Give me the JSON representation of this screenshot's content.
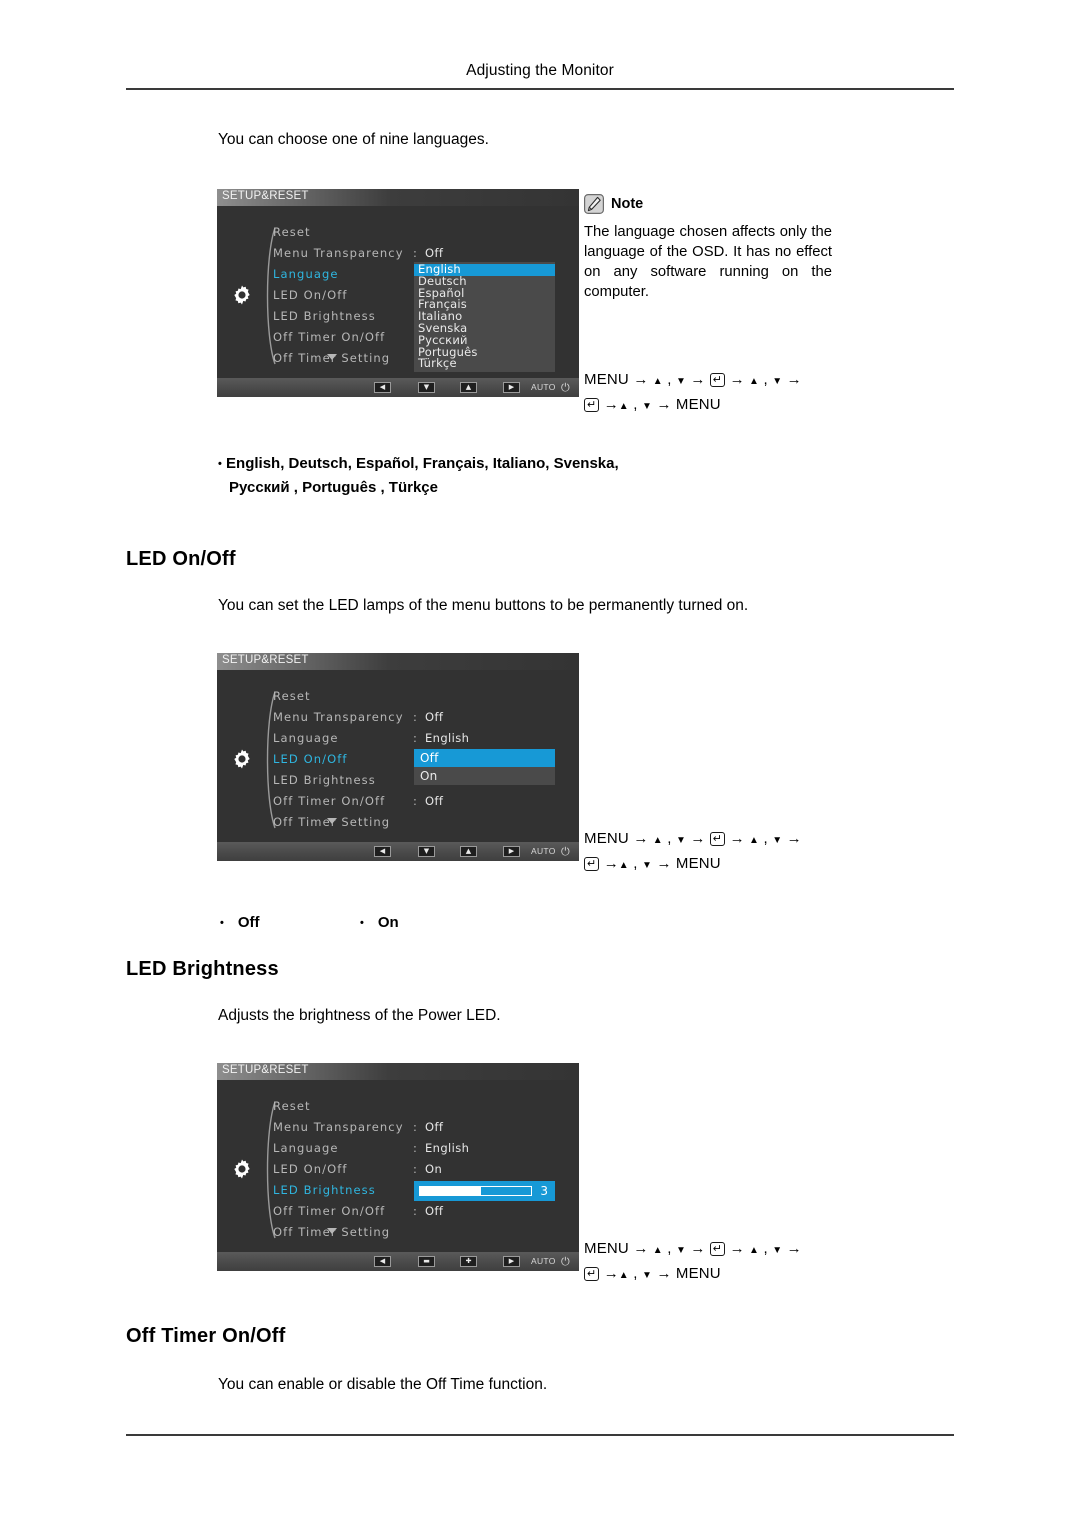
{
  "header": {
    "title": "Adjusting the Monitor"
  },
  "language_section": {
    "intro": "You can choose one of nine languages.",
    "osd": {
      "title": "SETUP&RESET",
      "rows": [
        {
          "label": "Reset",
          "colon": "",
          "value": ""
        },
        {
          "label": "Menu Transparency",
          "colon": ":",
          "value": "Off"
        },
        {
          "label": "Language",
          "colon": ":",
          "value": "",
          "active": true
        },
        {
          "label": "LED On/Off",
          "colon": ":",
          "value": ""
        },
        {
          "label": "LED Brightness",
          "colon": ":",
          "value": ""
        },
        {
          "label": "Off Timer On/Off",
          "colon": "",
          "value": ""
        },
        {
          "label": "Off Timer Setting",
          "colon": "",
          "value": ""
        }
      ],
      "dropdown": [
        "English",
        "Deutsch",
        "Español",
        "Français",
        "Italiano",
        "Svenska",
        "Русский",
        "Português",
        "Türkçe"
      ],
      "dropdown_selected": "English",
      "footer_buttons": [
        "◀",
        "▼",
        "▲",
        "▶"
      ],
      "footer_auto": "AUTO",
      "footer_power": "⏻"
    },
    "note": {
      "label": "Note",
      "text": "The language chosen affects only the language of the OSD. It has no effect on any software running on the computer."
    },
    "nav_line1_pre": "MENU",
    "nav_line2_post": "MENU",
    "options_line1": "English, Deutsch, Español, Français,  Italiano, Svenska,",
    "options_line2": "Русский , Português , Türkçe"
  },
  "led_onoff_section": {
    "heading": "LED On/Off",
    "description": "You can set the LED lamps of the menu buttons to be permanently turned on.",
    "osd": {
      "title": "SETUP&RESET",
      "rows": [
        {
          "label": "Reset",
          "colon": "",
          "value": ""
        },
        {
          "label": "Menu Transparency",
          "colon": ":",
          "value": "Off"
        },
        {
          "label": "Language",
          "colon": ":",
          "value": "English"
        },
        {
          "label": "LED On/Off",
          "colon": ":",
          "value": "",
          "active": true
        },
        {
          "label": "LED Brightness",
          "colon": ":",
          "value": ""
        },
        {
          "label": "Off Timer On/Off",
          "colon": ":",
          "value": "Off"
        },
        {
          "label": "Off Timer Setting",
          "colon": "",
          "value": ""
        }
      ],
      "dropdown": [
        "Off",
        "On"
      ],
      "dropdown_selected": "Off",
      "footer_buttons": [
        "◀",
        "▼",
        "▲",
        "▶"
      ],
      "footer_auto": "AUTO",
      "footer_power": "⏻"
    },
    "options": [
      "Off",
      "On"
    ]
  },
  "led_brightness_section": {
    "heading": "LED Brightness",
    "description": "Adjusts the brightness of the Power LED.",
    "osd": {
      "title": "SETUP&RESET",
      "rows": [
        {
          "label": "Reset",
          "colon": "",
          "value": ""
        },
        {
          "label": "Menu Transparency",
          "colon": ":",
          "value": "Off"
        },
        {
          "label": "Language",
          "colon": ":",
          "value": "English"
        },
        {
          "label": "LED On/Off",
          "colon": ":",
          "value": "On"
        },
        {
          "label": "LED Brightness",
          "colon": ":",
          "value": "",
          "active": true
        },
        {
          "label": "Off Timer On/Off",
          "colon": ":",
          "value": "Off"
        },
        {
          "label": "Off Timer Setting",
          "colon": "",
          "value": ""
        }
      ],
      "slider_value": "3",
      "slider_percent": 55,
      "footer_buttons": [
        "◀",
        "▬",
        "✚",
        "▶"
      ],
      "footer_auto": "AUTO",
      "footer_power": "⏻"
    }
  },
  "off_timer_section": {
    "heading": "Off Timer On/Off",
    "description": "You can enable or disable the Off Time function."
  },
  "colors": {
    "osd_background": "#323232",
    "osd_highlight": "#1799d6",
    "osd_active_label": "#2fb6e0",
    "osd_label": "#b7b7b7",
    "osd_value": "#e6e6e6",
    "rule": "#3a3a3a"
  }
}
